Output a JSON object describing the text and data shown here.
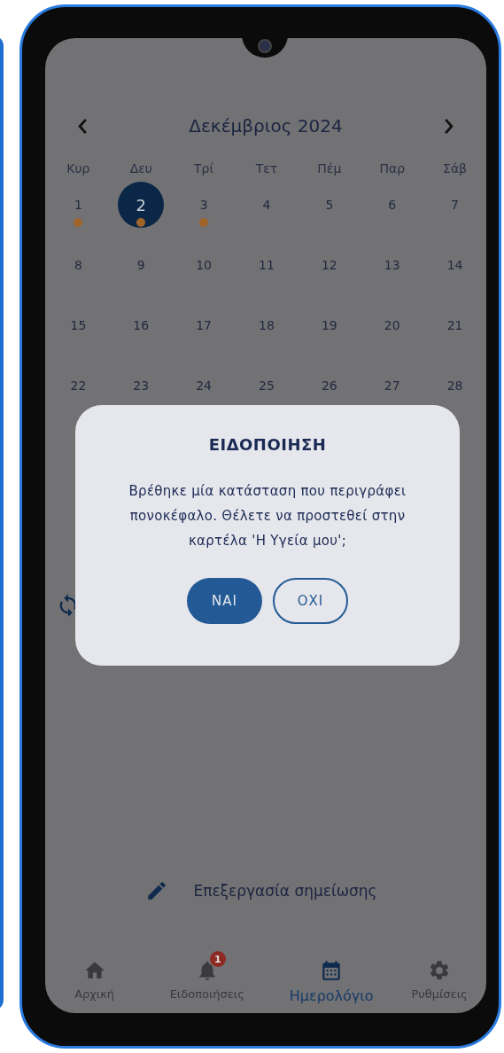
{
  "calendar": {
    "month": "Δεκέμβριος 2024",
    "weekdays": [
      "Κυρ",
      "Δευ",
      "Τρί",
      "Τετ",
      "Πέμ",
      "Παρ",
      "Σάβ"
    ],
    "weeks": [
      [
        {
          "day": "1",
          "selected": false,
          "event": true
        },
        {
          "day": "2",
          "selected": true,
          "event": true
        },
        {
          "day": "3",
          "selected": false,
          "event": true
        },
        {
          "day": "4",
          "selected": false,
          "event": false
        },
        {
          "day": "5",
          "selected": false,
          "event": false
        },
        {
          "day": "6",
          "selected": false,
          "event": false
        },
        {
          "day": "7",
          "selected": false,
          "event": false
        }
      ],
      [
        {
          "day": "8",
          "selected": false,
          "event": false
        },
        {
          "day": "9",
          "selected": false,
          "event": false
        },
        {
          "day": "10",
          "selected": false,
          "event": false
        },
        {
          "day": "11",
          "selected": false,
          "event": false
        },
        {
          "day": "12",
          "selected": false,
          "event": false
        },
        {
          "day": "13",
          "selected": false,
          "event": false
        },
        {
          "day": "14",
          "selected": false,
          "event": false
        }
      ],
      [
        {
          "day": "15",
          "selected": false,
          "event": false
        },
        {
          "day": "16",
          "selected": false,
          "event": false
        },
        {
          "day": "17",
          "selected": false,
          "event": false
        },
        {
          "day": "18",
          "selected": false,
          "event": false
        },
        {
          "day": "19",
          "selected": false,
          "event": false
        },
        {
          "day": "20",
          "selected": false,
          "event": false
        },
        {
          "day": "21",
          "selected": false,
          "event": false
        }
      ],
      [
        {
          "day": "22",
          "selected": false,
          "event": false
        },
        {
          "day": "23",
          "selected": false,
          "event": false
        },
        {
          "day": "24",
          "selected": false,
          "event": false
        },
        {
          "day": "25",
          "selected": false,
          "event": false
        },
        {
          "day": "26",
          "selected": false,
          "event": false
        },
        {
          "day": "27",
          "selected": false,
          "event": false
        },
        {
          "day": "28",
          "selected": false,
          "event": false
        }
      ]
    ]
  },
  "edit_note": {
    "label": "Επεξεργασία σημείωσης"
  },
  "dialog": {
    "title": "ΕΙΔΟΠΟΙΗΣΗ",
    "message": "Βρέθηκε μία κατάσταση που περιγράφει πονοκέφαλο. Θέλετε να προστεθεί στην καρτέλα 'Η Υγεία μου';",
    "buttons": [
      {
        "label": "ΝΑΙ",
        "kind": "primary"
      },
      {
        "label": "ΟΧΙ",
        "kind": "outline"
      }
    ]
  },
  "bottom_nav": [
    {
      "label": "Αρχική",
      "kind": "home",
      "selected": false
    },
    {
      "label": "Ειδοποιήσεις",
      "kind": "bell",
      "selected": false,
      "badge": "1"
    },
    {
      "label": "Ημερολόγιο",
      "kind": "calendar",
      "selected": true
    },
    {
      "label": "Ρυθμίσεις",
      "kind": "gear",
      "selected": false
    }
  ]
}
